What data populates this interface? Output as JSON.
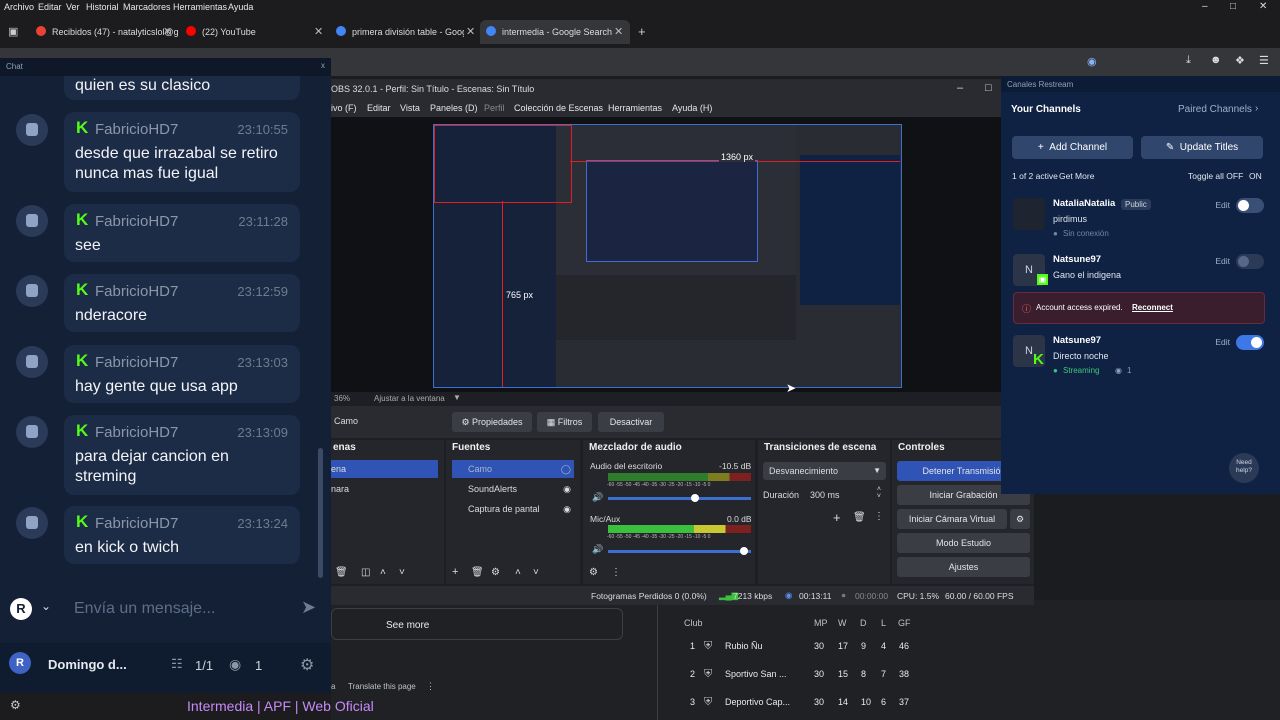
{
  "menubar": {
    "items": [
      "Archivo",
      "Editar",
      "Ver",
      "Historial",
      "Marcadores",
      "Herramientas",
      "Ayuda"
    ]
  },
  "tabs": [
    {
      "label": "Recibidos (47) - natalyticslol@g",
      "icon_color": "#ea4335"
    },
    {
      "label": "(22) YouTube",
      "icon_color": "#ff0000"
    },
    {
      "label": "primera división table - Google",
      "icon_color": "#4285f4"
    },
    {
      "label": "intermedia - Google Search",
      "icon_color": "#4285f4"
    }
  ],
  "chat": {
    "title": "Chat",
    "close": "x",
    "first_text": "quien es su clasico",
    "messages": [
      {
        "user": "FabricioHD7",
        "time": "23:10:55",
        "text": "desde que irrazabal se retiro nunca mas fue igual"
      },
      {
        "user": "FabricioHD7",
        "time": "23:11:28",
        "text": "see"
      },
      {
        "user": "FabricioHD7",
        "time": "23:12:59",
        "text": "nderacore"
      },
      {
        "user": "FabricioHD7",
        "time": "23:13:03",
        "text": "hay gente que usa app"
      },
      {
        "user": "FabricioHD7",
        "time": "23:13:09",
        "text": "para dejar cancion en streming"
      },
      {
        "user": "FabricioHD7",
        "time": "23:13:24",
        "text": "en kick o twich"
      }
    ],
    "placeholder": "Envía un mensaje...",
    "footer_name": "Domingo d...",
    "footer_count": "1/1",
    "footer_viewers": "1"
  },
  "obs": {
    "title": "OBS 32.0.1 - Perfil: Sin Título - Escenas: Sin Título",
    "menu": [
      "ivo (F)",
      "Editar",
      "Vista",
      "Paneles (D)",
      "Perfil",
      "Colección de Escenas",
      "Herramientas",
      "Ayuda (H)"
    ],
    "preview_dim1": "1360 px",
    "preview_dim2": "765 px",
    "zoom": "36%",
    "fit_label": "Ajustar a la ventana",
    "selected_source": "Camo",
    "btn_props": "Propiedades",
    "btn_filters": "Filtros",
    "btn_disable": "Desactivar",
    "scenes_title": "enas",
    "scenes": [
      "ena",
      "nara"
    ],
    "sources_title": "Fuentes",
    "sources": [
      "Camo",
      "SoundAlerts",
      "Captura de pantal"
    ],
    "mixer_title": "Mezclador de audio",
    "mixer": [
      {
        "name": "Audio del escritorio",
        "db": "-10.5 dB"
      },
      {
        "name": "Mic/Aux",
        "db": "0.0 dB"
      }
    ],
    "meter_scale": "-60 -55 -50 -45 -40 -35 -30 -25 -20 -15 -10 -5 0",
    "transitions_title": "Transiciones de escena",
    "transition": "Desvanecimiento",
    "duration_label": "Duración",
    "duration": "300 ms",
    "controls_title": "Controles",
    "controls": [
      "Detener Transmisión",
      "Iniciar Grabación",
      "Iniciar Cámara Virtual",
      "Modo Estudio",
      "Ajustes"
    ],
    "status": {
      "dropped": "Fotogramas Perdidos 0 (0.0%)",
      "bitrate": "7213 kbps",
      "stream_time": "00:13:11",
      "rec_time": "00:00:00",
      "cpu": "CPU: 1.5%",
      "fps": "60.00 / 60.00 FPS"
    }
  },
  "restream": {
    "title": "Canales Restream",
    "your_channels": "Your Channels",
    "paired": "Paired Channels",
    "add_channel": "Add Channel",
    "update_titles": "Update Titles",
    "active": "1 of 2 active",
    "get_more": "Get More",
    "toggle_all": "Toggle all OFF",
    "on": "ON",
    "edit": "Edit",
    "channels": [
      {
        "name": "NataliaNatalia",
        "badge": "Public",
        "sub": "pirdimus",
        "status": "Sin conexión",
        "on": false
      },
      {
        "name": "Natsune97",
        "badge": "",
        "sub": "Gano el indigena",
        "status": "",
        "on": false
      },
      {
        "name": "Natsune97",
        "badge": "",
        "sub": "Directo noche",
        "status": "Streaming",
        "viewers": "1",
        "on": true
      }
    ],
    "expired": "Account access expired.",
    "reconnect": "Reconnect",
    "need_help": "Need help?"
  },
  "google": {
    "see_more": "See more",
    "translate": "Translate this page",
    "link": "Intermedia | APF | Web Oficial",
    "headers": [
      "Club",
      "MP",
      "W",
      "D",
      "L",
      "GF"
    ],
    "rows": [
      {
        "pos": "1",
        "club": "Rubio Ñu",
        "mp": "30",
        "w": "17",
        "d": "9",
        "l": "4",
        "gf": "46"
      },
      {
        "pos": "2",
        "club": "Sportivo San ...",
        "mp": "30",
        "w": "15",
        "d": "8",
        "l": "7",
        "gf": "38"
      },
      {
        "pos": "3",
        "club": "Deportivo Cap...",
        "mp": "30",
        "w": "14",
        "d": "10",
        "l": "6",
        "gf": "37"
      }
    ]
  }
}
